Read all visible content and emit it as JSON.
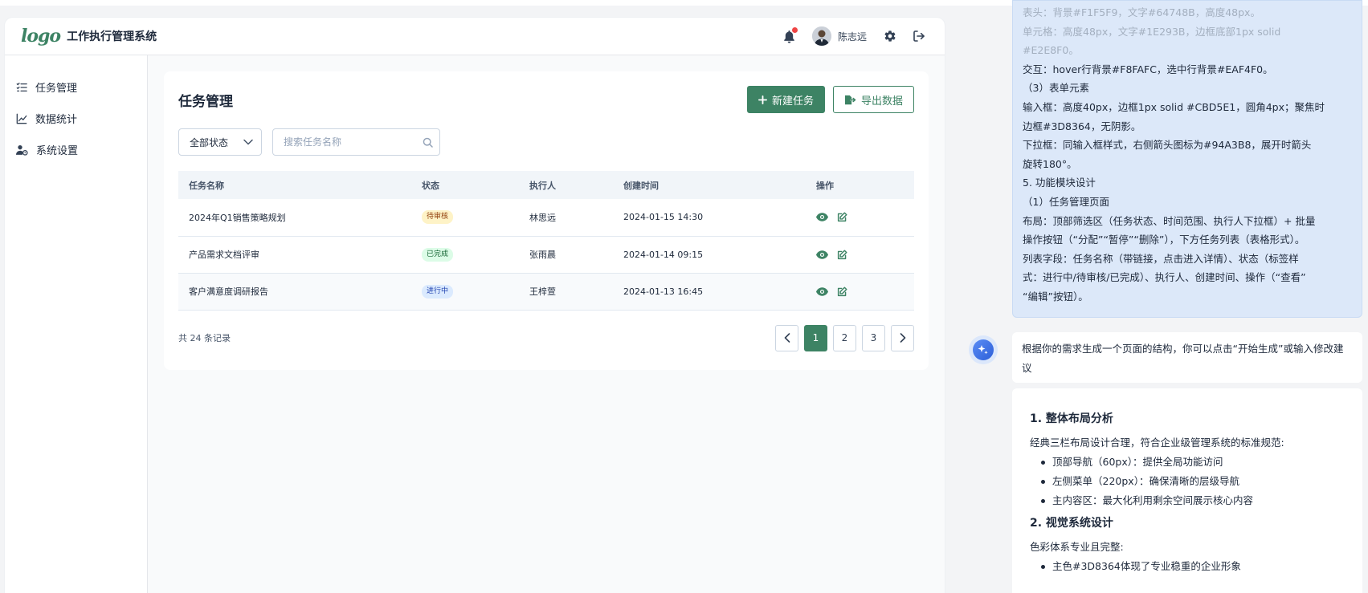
{
  "app": {
    "logo_text": "logo",
    "title": "工作执行管理系统",
    "user_name": "陈志远",
    "accent": "#3D8364",
    "notification_dot_color": "#EF4444"
  },
  "sidebar": {
    "items": [
      {
        "label": "任务管理",
        "icon": "task-list-icon"
      },
      {
        "label": "数据统计",
        "icon": "line-chart-icon"
      },
      {
        "label": "系统设置",
        "icon": "user-gear-icon"
      }
    ]
  },
  "page": {
    "title": "任务管理",
    "new_task_label": "新建任务",
    "export_label": "导出数据",
    "status_filter": "全部状态",
    "search_placeholder": "搜索任务名称"
  },
  "table": {
    "headers": [
      "任务名称",
      "状态",
      "执行人",
      "创建时间",
      "操作"
    ],
    "rows": [
      {
        "name": "2024年Q1销售策略规划",
        "status": "待审核",
        "assignee": "林思远",
        "created": "2024-01-15 14:30"
      },
      {
        "name": "产品需求文档评审",
        "status": "已完成",
        "assignee": "张雨晨",
        "created": "2024-01-14 09:15"
      },
      {
        "name": "客户满意度调研报告",
        "status": "进行中",
        "assignee": "王梓萱",
        "created": "2024-01-13 16:45"
      }
    ],
    "status_colors": {
      "待审核": {
        "bg": "#FEF3C7",
        "fg": "#92400E"
      },
      "已完成": {
        "bg": "#DCFCE7",
        "fg": "#166534"
      },
      "进行中": {
        "bg": "#DBEAFE",
        "fg": "#1E40AF"
      }
    }
  },
  "pagination": {
    "total_text": "共 24 条记录",
    "pages": [
      "1",
      "2",
      "3"
    ],
    "current": "1"
  },
  "chat": {
    "user_message_lines": [
      "表头：背景#F1F5F9，文字#64748B，高度48px。",
      "单元格：高度48px，文字#1E293B，边框底部1px solid",
      "#E2E8F0。",
      "交互：hover行背景#F8FAFC，选中行背景#EAF4F0。",
      "（3）表单元素",
      "输入框：高度40px，边框1px solid #CBD5E1，圆角4px；聚焦时",
      "边框#3D8364，无阴影。",
      "下拉框：同输入框样式，右侧箭头图标为#94A3B8，展开时箭头",
      "旋转180°。",
      "5. 功能模块设计",
      "（1）任务管理页面",
      "布局：顶部筛选区（任务状态、时间范围、执行人下拉框）+ 批量",
      "操作按钮（“分配”“暂停”“删除”），下方任务列表（表格形式）。",
      "列表字段：任务名称（带链接，点击进入详情）、状态（标签样",
      "式：进行中/待审核/已完成）、执行人、创建时间、操作（“查看”",
      "“编辑”按钮）。"
    ],
    "bot_reply": "根据你的需求生成一个页面的结构，你可以点击“开始生成”或输入修改建议",
    "analysis": {
      "section1_title": "1. 整体布局分析",
      "section1_intro": "经典三栏布局设计合理，符合企业级管理系统的标准规范:",
      "section1_bullets": [
        "顶部导航（60px）：提供全局功能访问",
        "左侧菜单（220px）：确保清晰的层级导航",
        "主内容区：最大化利用剩余空间展示核心内容"
      ],
      "section2_title": "2. 视觉系统设计",
      "section2_intro": "色彩体系专业且完整:",
      "section2_bullets": [
        "主色#3D8364体现了专业稳重的企业形象"
      ]
    }
  }
}
